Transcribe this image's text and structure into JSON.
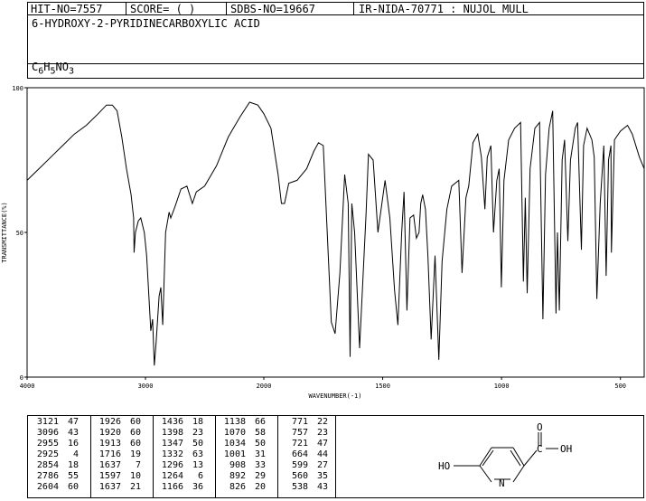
{
  "header": {
    "hit_no": "HIT-NO=7557",
    "score": "SCORE=  (   )",
    "sdbs_no": "SDBS-NO=19667",
    "ir": "IR-NIDA-70771 : NUJOL MULL"
  },
  "compound": {
    "name": "6-HYDROXY-2-PYRIDINECARBOXYLIC ACID",
    "formula_parts": [
      "C",
      "6",
      "H",
      "5",
      "N",
      "O",
      "3"
    ]
  },
  "chart_data": {
    "type": "line",
    "xlabel": "WAVENUMBER(-1)",
    "ylabel": "TRANSMITTANCE(%)",
    "xlim": [
      4000,
      400
    ],
    "ylim": [
      0,
      100
    ],
    "x_ticks": [
      4000,
      3000,
      2000,
      1500,
      1000,
      500
    ],
    "y_ticks": [
      0,
      50,
      100
    ],
    "grid": false,
    "series": [
      {
        "points": [
          [
            4000,
            68
          ],
          [
            3900,
            72
          ],
          [
            3800,
            76
          ],
          [
            3700,
            80
          ],
          [
            3600,
            84
          ],
          [
            3500,
            87
          ],
          [
            3400,
            91
          ],
          [
            3330,
            94
          ],
          [
            3280,
            94
          ],
          [
            3240,
            92
          ],
          [
            3200,
            83
          ],
          [
            3160,
            72
          ],
          [
            3121,
            63
          ],
          [
            3100,
            55
          ],
          [
            3096,
            43
          ],
          [
            3085,
            50
          ],
          [
            3060,
            54
          ],
          [
            3040,
            55
          ],
          [
            3010,
            50
          ],
          [
            2990,
            42
          ],
          [
            2955,
            16
          ],
          [
            2940,
            20
          ],
          [
            2925,
            4
          ],
          [
            2910,
            12
          ],
          [
            2885,
            28
          ],
          [
            2870,
            31
          ],
          [
            2854,
            18
          ],
          [
            2830,
            50
          ],
          [
            2800,
            57
          ],
          [
            2786,
            55
          ],
          [
            2750,
            59
          ],
          [
            2700,
            65
          ],
          [
            2650,
            66
          ],
          [
            2604,
            60
          ],
          [
            2570,
            64
          ],
          [
            2500,
            66
          ],
          [
            2400,
            73
          ],
          [
            2300,
            83
          ],
          [
            2200,
            90
          ],
          [
            2120,
            95
          ],
          [
            2050,
            94
          ],
          [
            2000,
            91
          ],
          [
            1970,
            86
          ],
          [
            1940,
            70
          ],
          [
            1926,
            60
          ],
          [
            1920,
            60
          ],
          [
            1913,
            60
          ],
          [
            1895,
            67
          ],
          [
            1860,
            68
          ],
          [
            1820,
            72
          ],
          [
            1790,
            78
          ],
          [
            1770,
            81
          ],
          [
            1750,
            80
          ],
          [
            1716,
            19
          ],
          [
            1700,
            15
          ],
          [
            1680,
            36
          ],
          [
            1660,
            70
          ],
          [
            1645,
            60
          ],
          [
            1637,
            7
          ],
          [
            1630,
            60
          ],
          [
            1618,
            50
          ],
          [
            1597,
            10
          ],
          [
            1570,
            56
          ],
          [
            1560,
            77
          ],
          [
            1540,
            75
          ],
          [
            1520,
            50
          ],
          [
            1490,
            68
          ],
          [
            1470,
            55
          ],
          [
            1450,
            30
          ],
          [
            1436,
            18
          ],
          [
            1420,
            50
          ],
          [
            1410,
            64
          ],
          [
            1398,
            23
          ],
          [
            1385,
            55
          ],
          [
            1370,
            56
          ],
          [
            1358,
            48
          ],
          [
            1347,
            50
          ],
          [
            1340,
            60
          ],
          [
            1332,
            63
          ],
          [
            1320,
            58
          ],
          [
            1310,
            42
          ],
          [
            1296,
            13
          ],
          [
            1280,
            42
          ],
          [
            1264,
            6
          ],
          [
            1250,
            40
          ],
          [
            1230,
            58
          ],
          [
            1210,
            66
          ],
          [
            1180,
            68
          ],
          [
            1166,
            36
          ],
          [
            1150,
            62
          ],
          [
            1138,
            66
          ],
          [
            1120,
            81
          ],
          [
            1100,
            84
          ],
          [
            1085,
            76
          ],
          [
            1070,
            58
          ],
          [
            1060,
            76
          ],
          [
            1045,
            80
          ],
          [
            1034,
            50
          ],
          [
            1020,
            68
          ],
          [
            1010,
            72
          ],
          [
            1001,
            31
          ],
          [
            990,
            68
          ],
          [
            970,
            82
          ],
          [
            945,
            86
          ],
          [
            920,
            88
          ],
          [
            908,
            33
          ],
          [
            900,
            62
          ],
          [
            892,
            29
          ],
          [
            880,
            72
          ],
          [
            860,
            86
          ],
          [
            840,
            88
          ],
          [
            826,
            20
          ],
          [
            815,
            70
          ],
          [
            800,
            86
          ],
          [
            785,
            92
          ],
          [
            771,
            22
          ],
          [
            765,
            50
          ],
          [
            757,
            23
          ],
          [
            745,
            75
          ],
          [
            735,
            82
          ],
          [
            721,
            47
          ],
          [
            710,
            75
          ],
          [
            690,
            86
          ],
          [
            680,
            88
          ],
          [
            664,
            44
          ],
          [
            655,
            80
          ],
          [
            640,
            86
          ],
          [
            620,
            82
          ],
          [
            610,
            76
          ],
          [
            599,
            27
          ],
          [
            585,
            60
          ],
          [
            570,
            80
          ],
          [
            560,
            35
          ],
          [
            550,
            75
          ],
          [
            540,
            80
          ],
          [
            538,
            43
          ],
          [
            525,
            82
          ],
          [
            500,
            85
          ],
          [
            470,
            87
          ],
          [
            450,
            84
          ],
          [
            420,
            76
          ],
          [
            400,
            72
          ]
        ]
      }
    ]
  },
  "peak_table": {
    "columns": [
      [
        [
          "3121",
          "47"
        ],
        [
          "3096",
          "43"
        ],
        [
          "2955",
          "16"
        ],
        [
          "2925",
          "4"
        ],
        [
          "2854",
          "18"
        ],
        [
          "2786",
          "55"
        ],
        [
          "2604",
          "60"
        ]
      ],
      [
        [
          "1926",
          "60"
        ],
        [
          "1920",
          "60"
        ],
        [
          "1913",
          "60"
        ],
        [
          "1716",
          "19"
        ],
        [
          "1637",
          "7"
        ],
        [
          "1597",
          "10"
        ],
        [
          "1637",
          "21"
        ]
      ],
      [
        [
          "1436",
          "18"
        ],
        [
          "1398",
          "23"
        ],
        [
          "1347",
          "50"
        ],
        [
          "1332",
          "63"
        ],
        [
          "1296",
          "13"
        ],
        [
          "1264",
          "6"
        ],
        [
          "1166",
          "36"
        ]
      ],
      [
        [
          "1138",
          "66"
        ],
        [
          "1070",
          "58"
        ],
        [
          "1034",
          "50"
        ],
        [
          "1001",
          "31"
        ],
        [
          "908",
          "33"
        ],
        [
          "892",
          "29"
        ],
        [
          "826",
          "20"
        ]
      ],
      [
        [
          "771",
          "22"
        ],
        [
          "757",
          "23"
        ],
        [
          "721",
          "47"
        ],
        [
          "664",
          "44"
        ],
        [
          "599",
          "27"
        ],
        [
          "560",
          "35"
        ],
        [
          "538",
          "43"
        ]
      ]
    ]
  },
  "structure": {
    "ho_label": "HO",
    "n_label": "N",
    "o_label": "O",
    "oh_label": "OH",
    "c_label": "C"
  }
}
